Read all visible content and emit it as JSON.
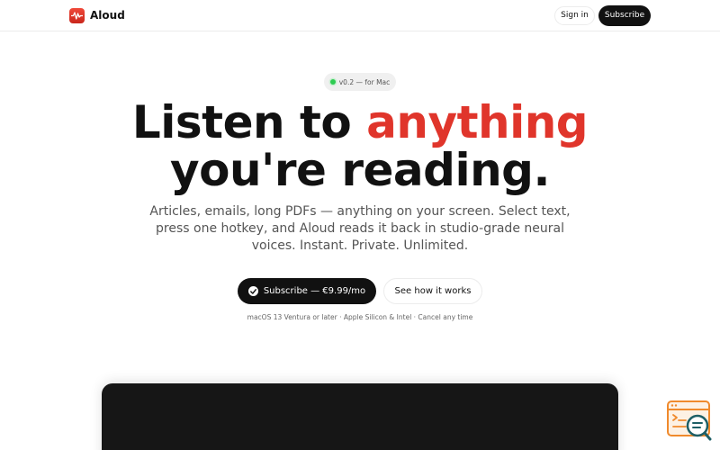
{
  "nav": {
    "brand": "Aloud",
    "sign_in": "Sign in",
    "subscribe": "Subscribe"
  },
  "badge": {
    "text": "v0.2 — for Mac",
    "status_color": "#2ecc52"
  },
  "hero": {
    "line1_plain": "Listen to ",
    "line1_accent": "anything",
    "line2": "you're reading.",
    "accent_color": "#e0352b",
    "description": "Articles, emails, long PDFs — anything on your screen. Select text, press one hotkey, and Aloud reads it back in studio-grade neural voices. Instant. Private. Unlimited."
  },
  "cta": {
    "primary": "Subscribe — €9.99/mo",
    "primary_icon": "check-circle-icon",
    "secondary": "See how it works"
  },
  "fine_print": "macOS 13 Ventura or later · Apple Silicon & Intel · Cancel any time",
  "icons": {
    "logo": "waveform-icon",
    "widget": "search-code-window-icon"
  },
  "colors": {
    "brand": "#e0352b",
    "dark": "#111111",
    "preview_bg": "#161616"
  }
}
